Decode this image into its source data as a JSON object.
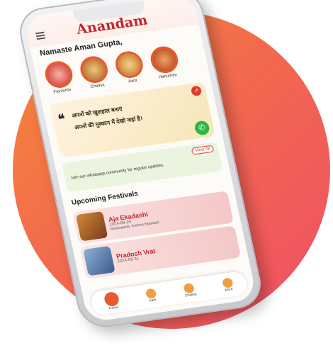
{
  "app": {
    "logo": "Anandam"
  },
  "greeting": "Namaste Aman Gupta,",
  "stories": [
    {
      "label": "Favourite"
    },
    {
      "label": "Chalisa"
    },
    {
      "label": "Aarti"
    },
    {
      "label": "Hanuman"
    }
  ],
  "quote": {
    "text_line1": "अपनों को खुशहाल बनाएं",
    "text_line2": "अपनों की मुस्कान में देखो जहां है।"
  },
  "join": {
    "text": "Join our whatsapp community for regular updates.",
    "view_all": "View All"
  },
  "festivals_title": "Upcoming Festivals",
  "festivals": [
    {
      "name": "Aja Ekadashi",
      "date": "2024-08-29",
      "sub": "Bhadrapada, Krishna Ekadashi"
    },
    {
      "name": "Pradosh Vrat",
      "date": "2024-08-31",
      "sub": ""
    }
  ],
  "nav": [
    {
      "label": "Home"
    },
    {
      "label": "Aarti"
    },
    {
      "label": "Chalisa"
    },
    {
      "label": "More"
    }
  ],
  "colors": {
    "brand": "#c0242b",
    "accent": "#e85a2c",
    "whatsapp": "#2bb741"
  }
}
